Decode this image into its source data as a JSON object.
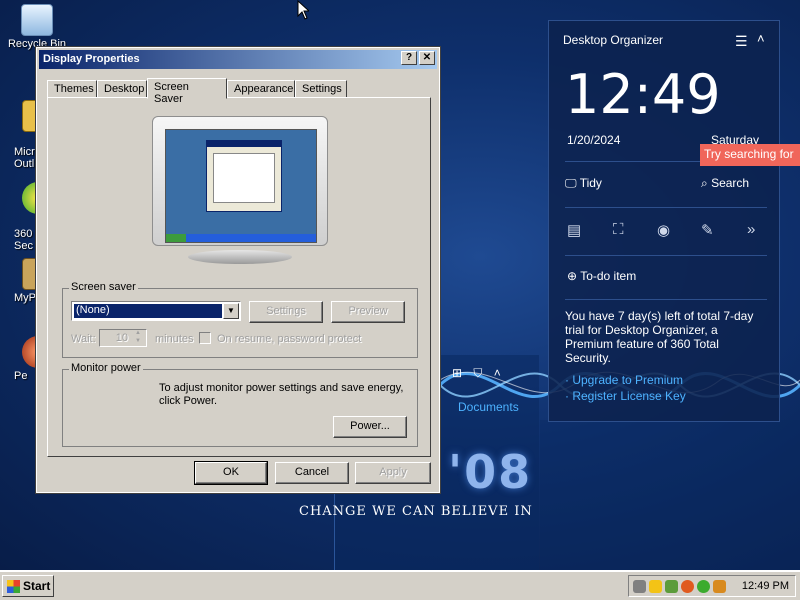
{
  "desktop": {
    "icons": [
      {
        "label": "Recycle Bin"
      },
      {
        "label": "Micr\nOutl"
      },
      {
        "label": "360\nSec"
      },
      {
        "label": "MyP"
      },
      {
        "label": "Pe"
      }
    ],
    "wallpaper": {
      "year": "'08",
      "slogan": "CHANGE WE CAN BELIEVE IN"
    }
  },
  "dialog": {
    "title": "Display Properties",
    "help_label": "?",
    "close_label": "✕",
    "tabs": [
      {
        "label": "Themes"
      },
      {
        "label": "Desktop"
      },
      {
        "label": "Screen Saver"
      },
      {
        "label": "Appearance"
      },
      {
        "label": "Settings"
      }
    ],
    "active_tab": "Screen Saver",
    "screen_saver": {
      "group_label": "Screen saver",
      "selected": "(None)",
      "settings_label": "Settings",
      "preview_label": "Preview",
      "wait_label": "Wait:",
      "wait_value": "10",
      "minutes_label": "minutes",
      "password_label": "On resume, password protect"
    },
    "monitor_power": {
      "group_label": "Monitor power",
      "description": "To adjust monitor power settings and save energy, click Power.",
      "power_label": "Power..."
    },
    "buttons": {
      "ok": "OK",
      "cancel": "Cancel",
      "apply": "Apply"
    }
  },
  "organizer": {
    "title": "Desktop Organizer",
    "time": "12:49",
    "date": "1/20/2024",
    "day": "Saturday",
    "tidy_label": "Tidy",
    "search_label": "Search",
    "tooltip": "Try searching for",
    "todo_label": "To-do item",
    "trial_text": "You have 7 day(s) left of total 7-day trial for Desktop Organizer, a Premium feature of 360 Total Security.",
    "upgrade_label": "· Upgrade to Premium",
    "register_label": "· Register License Key",
    "documents_label": "Documents"
  },
  "taskbar": {
    "start_label": "Start",
    "clock": "12:49 PM"
  },
  "colors": {
    "titlebar_start": "#0a246a",
    "titlebar_end": "#a6caf0",
    "organizer_bg": "#0c224e",
    "link": "#4db2ff",
    "tooltip_bg": "#f0665a",
    "desktop_bg": "#0e2f6b"
  }
}
